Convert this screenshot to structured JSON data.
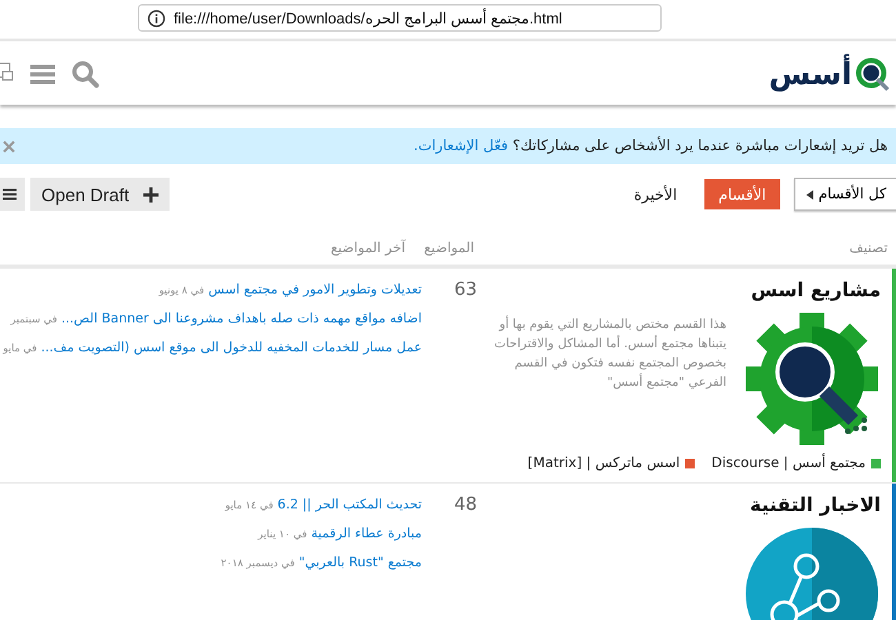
{
  "address_bar": {
    "url": "file:///home/user/Downloads/مجتمع أسس البرامج الحره.html"
  },
  "header": {
    "logo_text": "أسس"
  },
  "notice": {
    "text": "هل تريد إشعارات مباشرة عندما يرد الأشخاص على مشاركاتك؟",
    "link": "فعّل الإشعارات."
  },
  "nav": {
    "dropdown": "كل الأقسام",
    "tabs": [
      {
        "label": "الأقسام",
        "selected": true
      },
      {
        "label": "الأخيرة",
        "selected": false
      }
    ],
    "draft_button": "Open Draft"
  },
  "table": {
    "columns": [
      "تصنيف",
      "المواضيع",
      "آخر المواضيع"
    ],
    "rows": [
      {
        "kind": "gear",
        "title": "مشاريع اسس",
        "color": "#3ab54a",
        "description": "هذا القسم مختص بالمشاريع التي يقوم بها أو يتبناها مجتمع أسس. أما المشاكل والاقتراحات بخصوص المجتمع نفسه فتكون في القسم الفرعي \"مجتمع أسس\"",
        "subcategories": [
          {
            "name": "مجتمع أسس | Discourse",
            "color": "#3ab54a"
          },
          {
            "name": "اسس ماتركس | [Matrix]",
            "color": "#e45735"
          }
        ],
        "count": "63",
        "topics": [
          {
            "title": "تعديلات وتطوير الامور في مجتمع اسس",
            "date": "في ٨ يونيو"
          },
          {
            "title": "اضافه مواقع مهمه ذات صله باهداف مشروعنا الى Banner الص...",
            "date": "في سبتمبر"
          },
          {
            "title": "عمل مسار للخدمات المخفيه للدخول الى موقع اسس (التصويت مف...",
            "date": "في مايو"
          }
        ]
      },
      {
        "kind": "network",
        "title": "الاخبار التقنية",
        "color": "#0e76bd",
        "description": "",
        "subcategories": [],
        "count": "48",
        "topics": [
          {
            "title": "تحديث المكتب الحر || 6.2",
            "date": "في ١٤ مايو"
          },
          {
            "title": "مبادرة عطاء الرقمية",
            "date": "في ١٠ يناير"
          },
          {
            "title": "مجتمع \"Rust بالعربي\"",
            "date": "في ديسمبر ٢٠١٨"
          }
        ]
      }
    ]
  }
}
